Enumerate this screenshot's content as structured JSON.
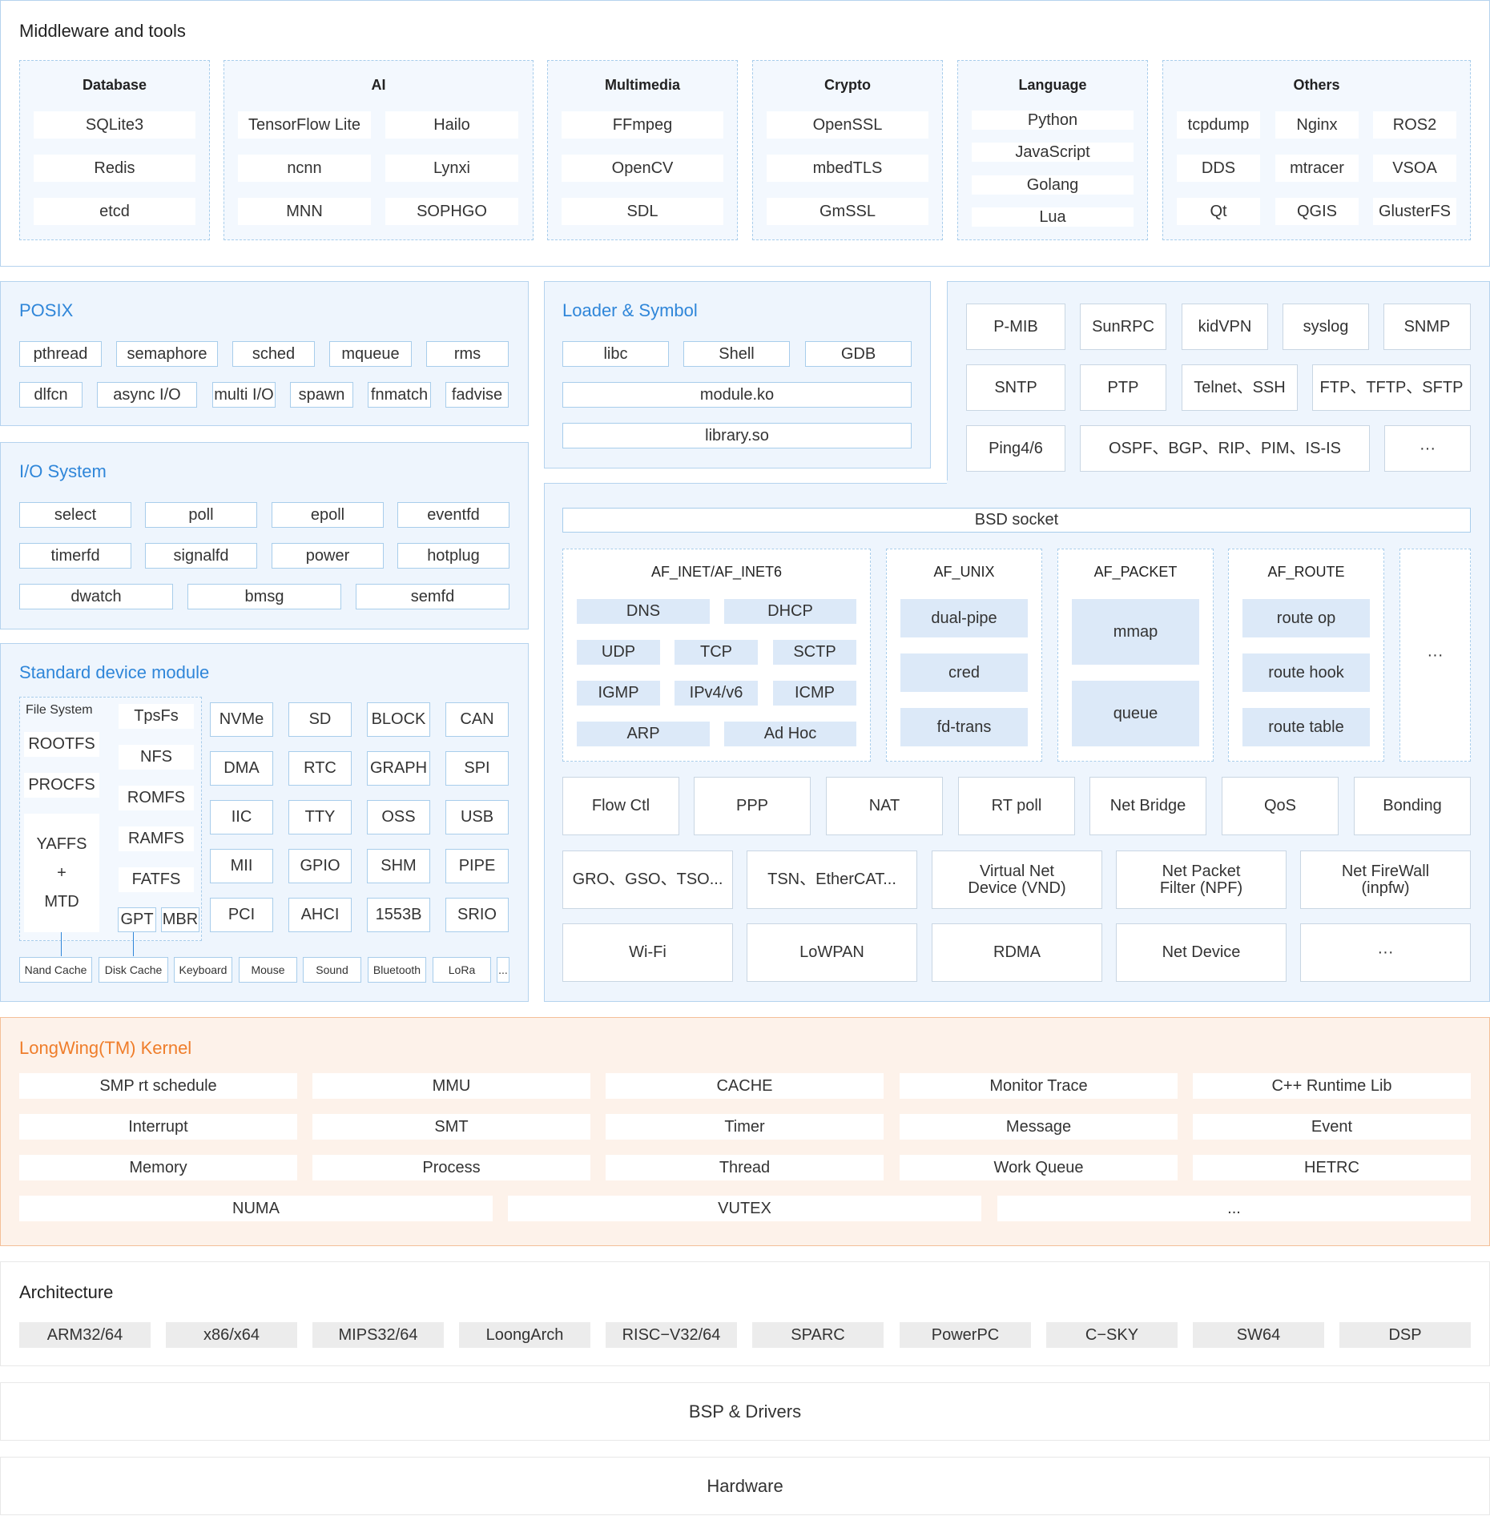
{
  "middleware": {
    "title": "Middleware and tools",
    "groups": [
      {
        "title": "Database",
        "items": [
          "SQLite3",
          "Redis",
          "etcd"
        ]
      },
      {
        "title": "AI",
        "items": [
          "TensorFlow Lite",
          "Hailo",
          "ncnn",
          "Lynxi",
          "MNN",
          "SOPHGO"
        ]
      },
      {
        "title": "Multimedia",
        "items": [
          "FFmpeg",
          "OpenCV",
          "SDL"
        ]
      },
      {
        "title": "Crypto",
        "items": [
          "OpenSSL",
          "mbedTLS",
          "GmSSL"
        ]
      },
      {
        "title": "Language",
        "items": [
          "Python",
          "JavaScript",
          "Golang",
          "Lua"
        ]
      },
      {
        "title": "Others",
        "items": [
          "tcpdump",
          "Nginx",
          "ROS2",
          "DDS",
          "mtracer",
          "VSOA",
          "Qt",
          "QGIS",
          "GlusterFS"
        ]
      }
    ]
  },
  "posix": {
    "title": "POSIX",
    "items": [
      "pthread",
      "semaphore",
      "sched",
      "mqueue",
      "rms",
      "dlfcn",
      "async I/O",
      "multi I/O",
      "spawn",
      "fnmatch",
      "fadvise"
    ]
  },
  "loader": {
    "title": "Loader & Symbol",
    "items": [
      "libc",
      "Shell",
      "GDB",
      "module.ko",
      "library.so"
    ]
  },
  "protocols": {
    "items": [
      "P-MIB",
      "SunRPC",
      "kidVPN",
      "syslog",
      "SNMP",
      "SNTP",
      "PTP",
      "Telnet、SSH",
      "FTP、TFTP、SFTP",
      "Ping4/6",
      "OSPF、BGP、RIP、PIM、IS-IS",
      "···"
    ]
  },
  "io": {
    "title": "I/O System",
    "items": [
      "select",
      "poll",
      "epoll",
      "eventfd",
      "timerfd",
      "signalfd",
      "power",
      "hotplug",
      "dwatch",
      "bmsg",
      "semfd"
    ]
  },
  "device": {
    "title": "Standard device module",
    "fs_title": "File System",
    "fs_left": [
      "ROOTFS",
      "PROCFS"
    ],
    "yaffs": [
      "YAFFS",
      "+",
      "MTD"
    ],
    "fs_right": [
      "TpsFs",
      "NFS",
      "ROMFS",
      "RAMFS",
      "FATFS"
    ],
    "gpt": "GPT",
    "mbr": "MBR",
    "grid": [
      "NVMe",
      "SD",
      "BLOCK",
      "CAN",
      "DMA",
      "RTC",
      "GRAPH",
      "SPI",
      "IIC",
      "TTY",
      "OSS",
      "USB",
      "MII",
      "GPIO",
      "SHM",
      "PIPE",
      "PCI",
      "AHCI",
      "1553B",
      "SRIO"
    ],
    "bottom": [
      "Nand Cache",
      "Disk Cache",
      "Keyboard",
      "Mouse",
      "Sound",
      "Bluetooth",
      "LoRa",
      "..."
    ]
  },
  "network": {
    "socket": "BSD socket",
    "af_inet": {
      "title": "AF_INET/AF_INET6",
      "items": [
        "DNS",
        "DHCP",
        "UDP",
        "TCP",
        "SCTP",
        "IGMP",
        "IPv4/v6",
        "ICMP",
        "ARP",
        "Ad Hoc"
      ]
    },
    "af_unix": {
      "title": "AF_UNIX",
      "items": [
        "dual-pipe",
        "cred",
        "fd-trans"
      ]
    },
    "af_packet": {
      "title": "AF_PACKET",
      "items": [
        "mmap",
        "queue"
      ]
    },
    "af_route": {
      "title": "AF_ROUTE",
      "items": [
        "route op",
        "route hook",
        "route table"
      ]
    },
    "af_more": "···",
    "row1": [
      "Flow Ctl",
      "PPP",
      "NAT",
      "RT poll",
      "Net Bridge",
      "QoS",
      "Bonding"
    ],
    "row2": [
      "GRO、GSO、TSO...",
      "TSN、EtherCAT...",
      "Virtual Net Device (VND)",
      "Net Packet Filter (NPF)",
      "Net FireWall (inpfw)"
    ],
    "row3": [
      "Wi-Fi",
      "LoWPAN",
      "RDMA",
      "Net Device",
      "···"
    ]
  },
  "kernel": {
    "title": "LongWing(TM) Kernel",
    "items": [
      "SMP rt schedule",
      "MMU",
      "CACHE",
      "Monitor Trace",
      "C++ Runtime Lib",
      "Interrupt",
      "SMT",
      "Timer",
      "Message",
      "Event",
      "Memory",
      "Process",
      "Thread",
      "Work Queue",
      "HETRC"
    ],
    "last": [
      "NUMA",
      "VUTEX",
      "..."
    ]
  },
  "architecture": {
    "title": "Architecture",
    "items": [
      "ARM32/64",
      "x86/x64",
      "MIPS32/64",
      "LoongArch",
      "RISC−V32/64",
      "SPARC",
      "PowerPC",
      "C−SKY",
      "SW64",
      "DSP"
    ]
  },
  "bsp": "BSP & Drivers",
  "hardware": "Hardware"
}
